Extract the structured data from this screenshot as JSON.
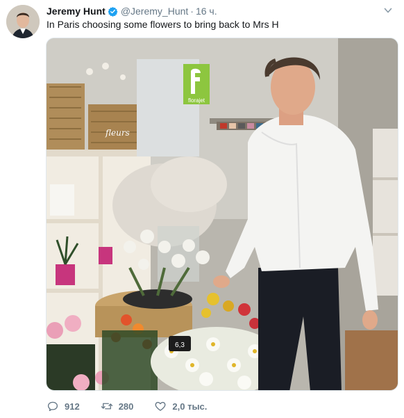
{
  "tweet": {
    "author_name": "Jeremy Hunt",
    "handle": "@Jeremy_Hunt",
    "separator": "·",
    "time": "16 ч.",
    "text": "In Paris choosing some flowers to bring back to Mrs H",
    "icons": {
      "verified": "verified-badge-icon",
      "menu": "chevron-down-icon",
      "reply": "reply-icon",
      "retweet": "retweet-icon",
      "like": "like-heart-icon"
    },
    "colors": {
      "verified": "#1da1f2",
      "muted": "#657786"
    }
  },
  "photo": {
    "sign_brand": "florajet",
    "shelf_sign": "fleurs",
    "price_tag": "6,3"
  },
  "actions": {
    "replies": "912",
    "retweets": "280",
    "likes": "2,0 тыс."
  }
}
